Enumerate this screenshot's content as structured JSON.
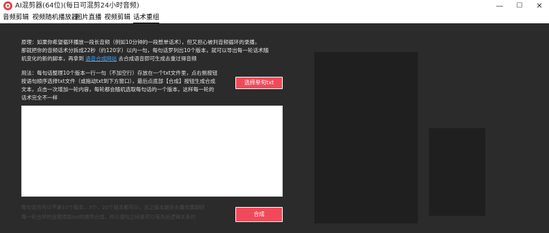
{
  "window": {
    "title": "AI混剪器(64位)(每日可混剪24小时音频)",
    "minimize": "—",
    "maximize": "☐",
    "close": "✕",
    "icon": "app-logo-icon"
  },
  "tabs": [
    {
      "label": "音频剪辑"
    },
    {
      "label": "视频随机播放器"
    },
    {
      "label": "图片直播"
    },
    {
      "label": "视频剪辑"
    },
    {
      "label": "话术重组",
      "active": true
    }
  ],
  "principle": {
    "line1": "原理：如果你希望循环播放一段长音频（例如10分钟的一段憋单话术），但又担心被判音频循环的录播，",
    "line2": "那就把你的音频话术分拆成22秒（约120字）以内一句，每句话罗列出10个版本，就可以导出每一轮话术随",
    "line3_prefix": "机变化的新的脚本，再拿到",
    "line3_link": "语音合成网站",
    "line3_suffix": "去合成语音即可生成去重过得音频"
  },
  "usage": {
    "line1": "用法：每句话整理10个版本一行一句（不加空行）存放在一个txt文件里，点右侧按钮",
    "line2": "按语句顺序选择txt文件（或拖动txt到下方窗口），最后点底部【合成】按钮生成合成",
    "line3": "文本，点击一次增加一轮内容，每轮都会随机选取每句话的一个版本，这样每一轮的",
    "line4": "话术完全不一样"
  },
  "buttons": {
    "select_file": "选择单句txt",
    "compose": "合成"
  },
  "text_area": {
    "value": ""
  },
  "footnote": {
    "line1": "每句话也可以不是10个版本，3个，20个版本都可以，总之版本越多去重效果越好",
    "line2": "每一轮合并时会按添加txt的顺序合成，所以语句之间是可以有先后逻辑关系的"
  },
  "colors": {
    "background": "#2b2b2b",
    "accent_button": "#f04a5a",
    "link": "#4aa3ff"
  }
}
